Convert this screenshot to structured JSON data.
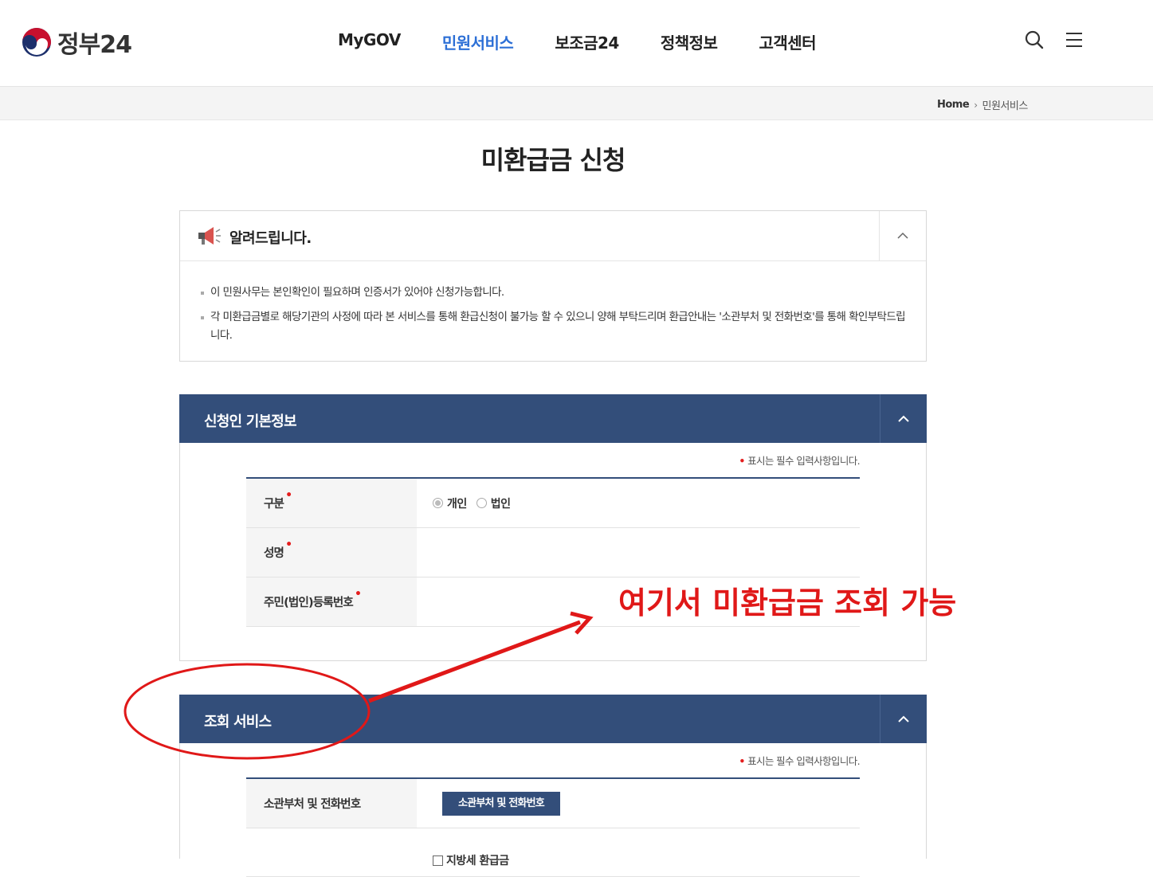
{
  "header": {
    "logo_text": "정부24",
    "nav": [
      {
        "label": "MyGOV",
        "active": false
      },
      {
        "label": "민원서비스",
        "active": true
      },
      {
        "label": "보조금24",
        "active": false
      },
      {
        "label": "정책정보",
        "active": false
      },
      {
        "label": "고객센터",
        "active": false
      }
    ],
    "icons": [
      "search-icon",
      "menu-icon"
    ]
  },
  "breadcrumb": {
    "home": "Home",
    "current": "민원서비스"
  },
  "page_title": "미환급금 신청",
  "notice": {
    "title": "알려드립니다.",
    "items": [
      "이 민원사무는 본인확인이 필요하며 인증서가 있어야 신청가능합니다.",
      "각 미환급금별로 해당기관의 사정에 따라 본 서비스를 통해 환급신청이 불가능 할 수 있으니 양해 부탁드리며 환급안내는 '소관부처 및 전화번호'를 통해 확인부탁드립니다."
    ]
  },
  "applicant_panel": {
    "title": "신청인 기본정보",
    "required_note": "표시는 필수 입력사항입니다.",
    "rows": [
      {
        "label": "구분",
        "required": true
      },
      {
        "label": "성명",
        "required": true
      },
      {
        "label": "주민(법인)등록번호",
        "required": true
      }
    ],
    "radio_options": [
      {
        "label": "개인",
        "checked": true
      },
      {
        "label": "법인",
        "checked": false
      }
    ]
  },
  "inquiry_panel": {
    "title": "조회 서비스",
    "required_note": "표시는 필수 입력사항입니다.",
    "rows": [
      {
        "label": "소관부처 및 전화번호"
      }
    ],
    "button_label": "소관부처 및 전화번호",
    "checkbox_label": "지방세 환급금"
  },
  "annotation": {
    "text": "여기서 미환급금 조회 가능",
    "color": "#e01818"
  },
  "colors": {
    "accent": "#2c6fd6",
    "panel_navy": "#334e7a",
    "required": "#e41e1e"
  }
}
